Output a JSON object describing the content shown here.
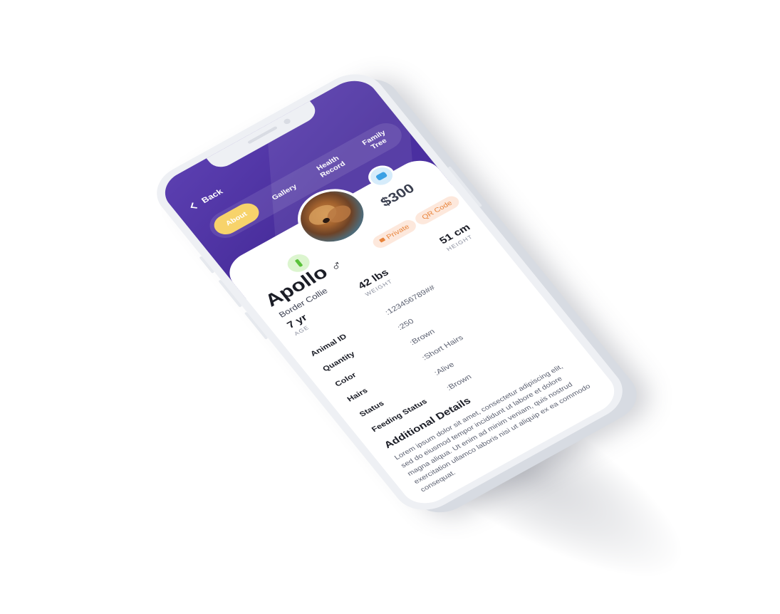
{
  "header": {
    "back_label": "Back",
    "tabs": [
      {
        "label": "About",
        "active": true
      },
      {
        "label": "Gallery",
        "active": false
      },
      {
        "label": "Health Record",
        "active": false
      },
      {
        "label": "Family Tree",
        "active": false
      }
    ]
  },
  "pet": {
    "name": "Apollo",
    "gender_symbol": "♂",
    "breed": "Border Collie",
    "price": "$300",
    "private_label": "Private",
    "qr_label": "QR Code"
  },
  "stats": [
    {
      "value": "7 yr",
      "label": "AGE"
    },
    {
      "value": "42 lbs",
      "label": "WEIGHT"
    },
    {
      "value": "51 cm",
      "label": "HEIGHT"
    }
  ],
  "details": [
    {
      "label": "Animal ID",
      "value": ":123456789##"
    },
    {
      "label": "Quantity",
      "value": ":250"
    },
    {
      "label": "Color",
      "value": ":Brown"
    },
    {
      "label": "Hairs",
      "value": ":Short Hairs"
    },
    {
      "label": "Status",
      "value": ":Alive"
    },
    {
      "label": "Feeding Status",
      "value": ":Brown"
    }
  ],
  "additional": {
    "title": "Additional Details",
    "body": "Lorem ipsum dolor sit amet, consectetur adipiscing elit, sed do eiusmod tempor incididunt ut labore et dolore magna aliqua. Ut enim ad minim veniam, quis nostrud exercitation ullamco laboris nisi ut aliquip ex ea commodo consequat."
  },
  "colors": {
    "header_purple": "#4a2f9e",
    "active_tab": "#f7d36b",
    "pill_orange": "#e8843b",
    "green_badge": "#5ac23a",
    "blue_badge": "#3aa0e4"
  }
}
